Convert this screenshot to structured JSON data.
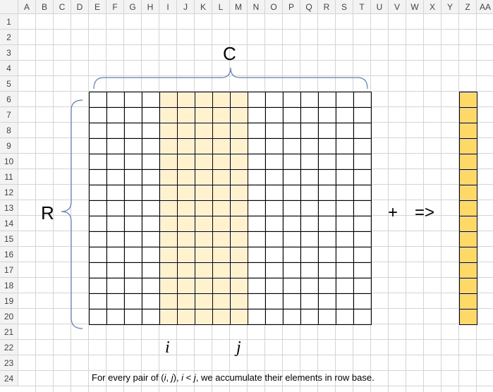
{
  "sheet": {
    "columns": [
      "A",
      "B",
      "C",
      "D",
      "E",
      "F",
      "G",
      "H",
      "I",
      "J",
      "K",
      "L",
      "M",
      "N",
      "O",
      "P",
      "Q",
      "R",
      "S",
      "T",
      "U",
      "V",
      "W",
      "X",
      "Y",
      "Z",
      "AA"
    ],
    "rows": [
      "1",
      "2",
      "3",
      "4",
      "5",
      "6",
      "7",
      "8",
      "9",
      "10",
      "11",
      "12",
      "13",
      "14",
      "15",
      "16",
      "17",
      "18",
      "19",
      "20",
      "21",
      "22",
      "23",
      "24"
    ],
    "gridline_color": "#d4d4d4",
    "header_bg": "#f3f3f3"
  },
  "diagram": {
    "col_label": "C",
    "row_label": "R",
    "i_label": "i",
    "j_label": "j",
    "plus": "+",
    "arrow": "=>",
    "matrix_rows": 15,
    "matrix_cols": 16,
    "highlight_cols": [
      4,
      5,
      6,
      7,
      8
    ],
    "result_cells": 15,
    "highlight_color": "#fff2cc",
    "result_color": "#ffd966",
    "brace_color": "#5b7fc4"
  },
  "note": {
    "t1": "For every pair of (",
    "i": "i",
    "t2": ", ",
    "j": "j",
    "t3": "), ",
    "i2": "i",
    "t4": " <  ",
    "j2": "j",
    "t5": ", we accumulate their elements in row base."
  }
}
